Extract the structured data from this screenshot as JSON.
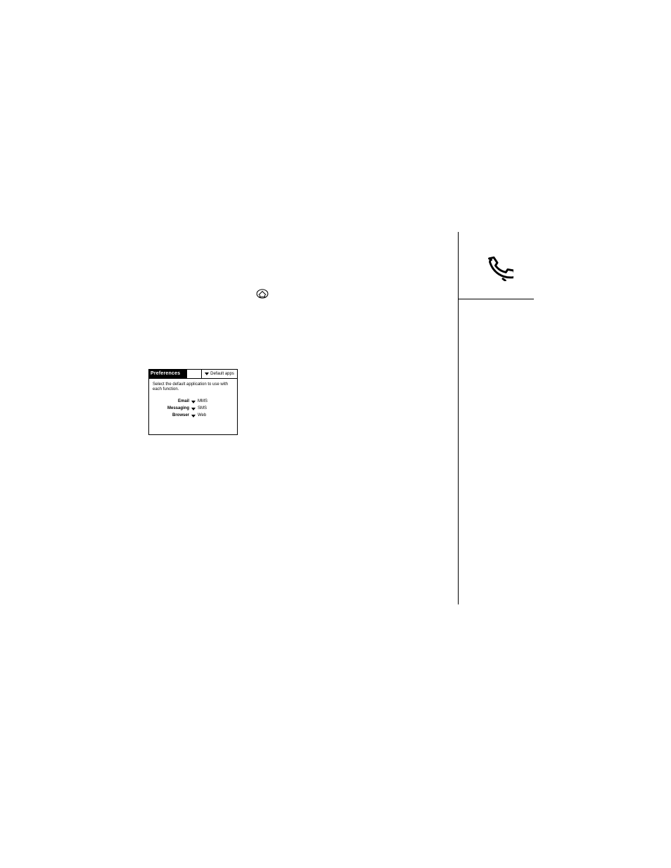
{
  "prefs": {
    "title": "Preferences",
    "dropdown": "Default apps",
    "instruction": "Select the default application to use with each function.",
    "rows": [
      {
        "label": "Email",
        "value": "MMS"
      },
      {
        "label": "Messaging",
        "value": "SMS"
      },
      {
        "label": "Browser",
        "value": "Web"
      }
    ]
  },
  "icons": {
    "phone": "phone-icon",
    "home": "home-icon"
  }
}
